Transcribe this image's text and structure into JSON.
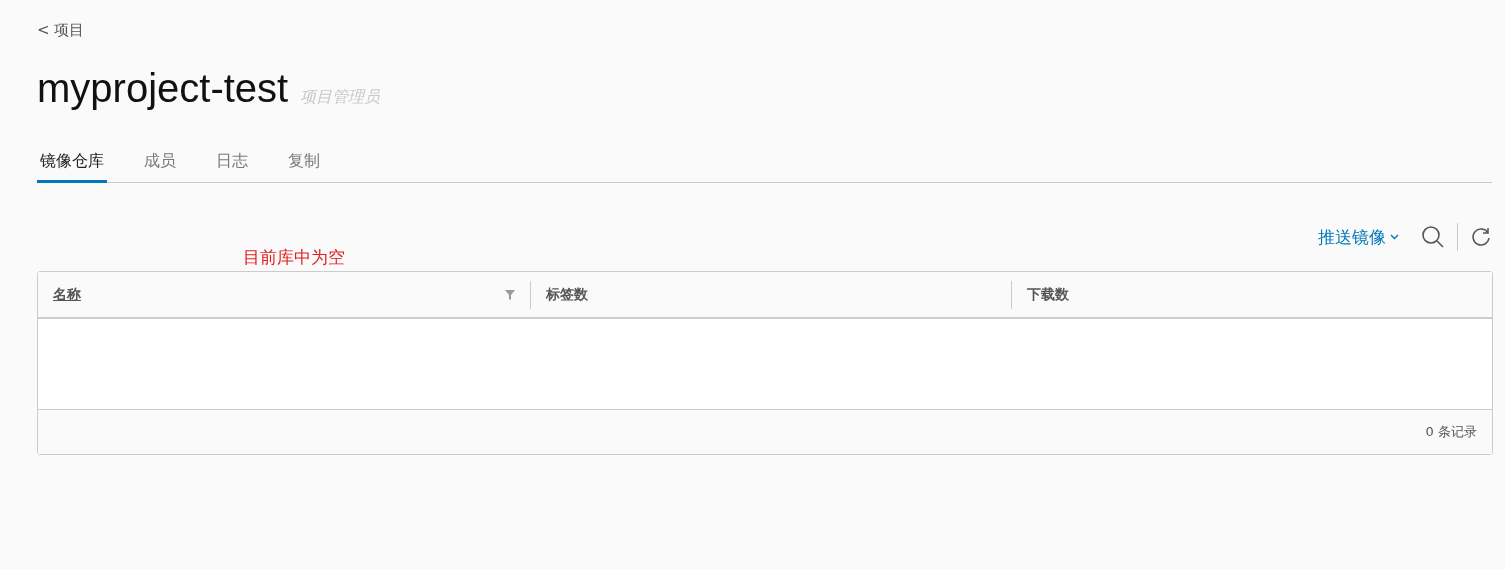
{
  "breadcrumb": "< 项目",
  "title": "myproject-test",
  "role": "项目管理员",
  "tabs": [
    {
      "label": "镜像仓库",
      "selected": true
    },
    {
      "label": "成员",
      "selected": false
    },
    {
      "label": "日志",
      "selected": false
    },
    {
      "label": "复制",
      "selected": false
    }
  ],
  "note": "目前库中为空",
  "toolbar": {
    "push_button": "推送镜像"
  },
  "table": {
    "columns": [
      {
        "label": "名称",
        "filter": true
      },
      {
        "label": "标签数",
        "filter": false
      },
      {
        "label": "下载数",
        "filter": false
      }
    ],
    "footer": "0 条记录"
  }
}
